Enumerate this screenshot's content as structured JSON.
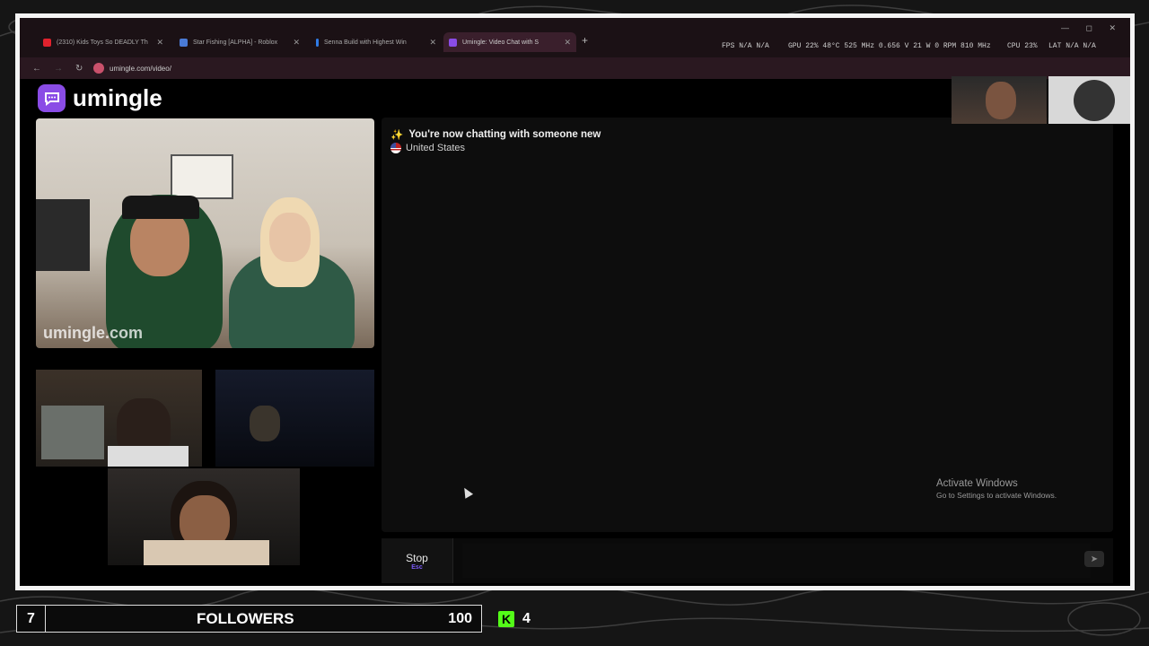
{
  "browser": {
    "tabs": [
      {
        "label": "(2310) Kids Toys So DEADLY Th",
        "fav_color": "#e0222d",
        "active": false
      },
      {
        "label": "Star Fishing [ALPHA] - Roblox",
        "fav_color": "#4a7bd6",
        "active": false
      },
      {
        "label": "Senna Build with Highest Win",
        "fav_color": "#2f7be5",
        "active": false
      },
      {
        "label": "Umingle: Video Chat with S",
        "fav_color": "#8a4ce6",
        "active": true
      }
    ],
    "new_tab": "+",
    "window_controls": "— ◻ ✕",
    "url": "umingle.com/video/"
  },
  "osd": {
    "fps": "FPS  N/A  N/A",
    "gpu": "GPU 22%  48°C  525 MHz  0.656 V  21 W  0 RPM  810 MHz",
    "cpu": "CPU 23%",
    "lat": "LAT  N/A  N/A"
  },
  "site": {
    "name": "umingle",
    "watermark": "umingle.com"
  },
  "chat": {
    "status": "You're now chatting with someone new",
    "status_icon": "✨",
    "country": "United States",
    "stop_label": "Stop",
    "stop_key": "Esc"
  },
  "windows_notice": {
    "title": "Activate Windows",
    "subtitle": "Go to Settings to activate Windows."
  },
  "stream": {
    "followers_current": "7",
    "followers_label": "FOLLOWERS",
    "followers_goal": "100",
    "kick_letter": "K",
    "kick_viewers": "4",
    "kick_color": "#53fc18"
  }
}
